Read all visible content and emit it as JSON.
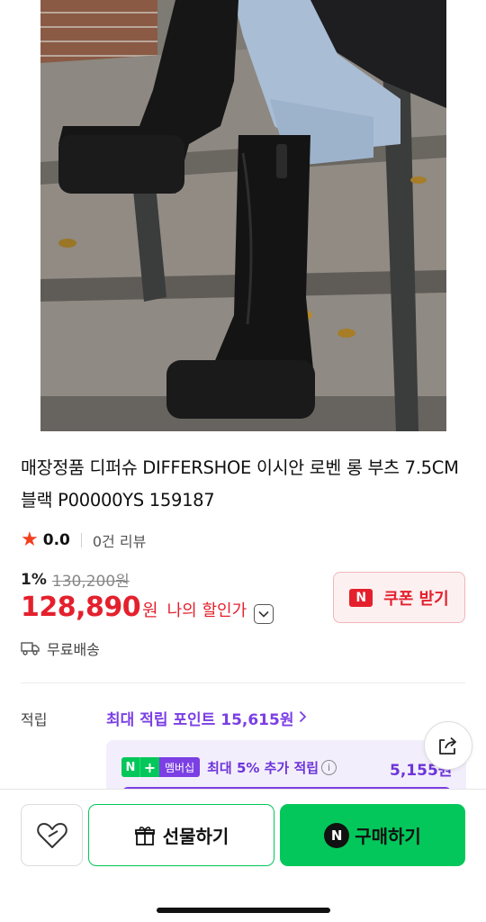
{
  "product": {
    "title": "매장정품 디퍼슈 DIFFERSHOE 이시안 로벤 롱 부츠 7.5CM 블랙 P00000YS 159187",
    "rating": "0.0",
    "review_count": "0건 리뷰"
  },
  "pricing": {
    "discount_percent": "1%",
    "original_price": "130,200원",
    "sale_price": "128,890",
    "currency": "원",
    "my_discount_label": "나의 할인가"
  },
  "coupon": {
    "badge": "N",
    "label": "쿠폰 받기"
  },
  "shipping": {
    "label": "무료배송"
  },
  "points": {
    "label": "적립",
    "max_points_link": "최대 적립 포인트 15,615원",
    "membership": {
      "badge_n": "N",
      "badge_plus": "+",
      "badge_text": "멤버십",
      "text": "최대 5% 추가 적립",
      "amount": "5,155원"
    }
  },
  "actions": {
    "gift_label": "선물하기",
    "buy_badge": "N",
    "buy_label": "구매하기"
  },
  "colors": {
    "accent_red": "#e4202d",
    "naver_green": "#03c75a",
    "membership_purple": "#7b3fe4"
  },
  "icons": [
    "star-icon",
    "chevron-down-icon",
    "truck-icon",
    "chevron-right-icon",
    "info-icon",
    "share-icon",
    "heart-icon",
    "gift-icon"
  ]
}
